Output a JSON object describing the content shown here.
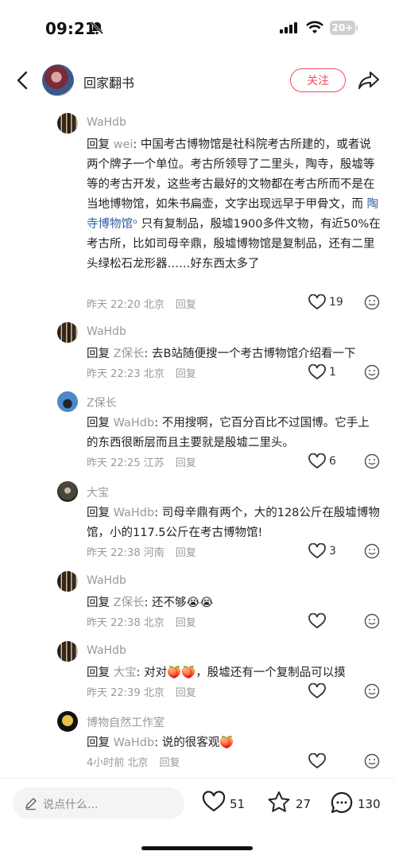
{
  "status": {
    "time": "09:21",
    "battery": "20+"
  },
  "header": {
    "title": "回家翻书",
    "follow_label": "关注"
  },
  "comments": [
    {
      "name": "WaHdb",
      "reply_prefix": "回复 ",
      "reply_to": "wei",
      "text_a": ": 中国考古博物馆是社科院考古所建的，或者说两个牌子一个单位。考古所领导了二里头，陶寺，殷墟等等的考古开发，这些考古最好的文物都在考古所而不是在当地博物馆，如朱书扁壶，文字出现远早于甲骨文，而 ",
      "link": "陶寺博物馆",
      "text_b": " 只有复制品，殷墟1900多件文物，有近50%在考古所，比如司母辛鼎，殷墟博物馆是复制品，还有二里头绿松石龙形器……好东西太多了",
      "time": "昨天 22:20",
      "loc": "北京",
      "reply": "回复",
      "likes": "19"
    },
    {
      "name": "WaHdb",
      "reply_prefix": "回复 ",
      "reply_to": "Z保长",
      "text_a": ": 去B站随便搜一个考古博物馆介绍看一下",
      "time": "昨天 22:23",
      "loc": "北京",
      "reply": "回复",
      "likes": "1"
    },
    {
      "name": "Z保长",
      "reply_prefix": "回复 ",
      "reply_to": "WaHdb",
      "text_a": ": 不用搜啊，它百分百比不过国博。它手上的东西很断层而且主要就是殷墟二里头。",
      "time": "昨天 22:25",
      "loc": "江苏",
      "reply": "回复",
      "likes": "6"
    },
    {
      "name": "大宝",
      "reply_prefix": "回复 ",
      "reply_to": "WaHdb",
      "text_a": ": 司母辛鼎有两个，大的128公斤在殷墟博物馆，小的117.5公斤在考古博物馆!",
      "time": "昨天 22:38",
      "loc": "河南",
      "reply": "回复",
      "likes": "3"
    },
    {
      "name": "WaHdb",
      "reply_prefix": "回复 ",
      "reply_to": "Z保长",
      "text_a": ": 还不够",
      "emoji": "😭😭",
      "time": "昨天 22:38",
      "loc": "北京",
      "reply": "回复"
    },
    {
      "name": "WaHdb",
      "reply_prefix": "回复 ",
      "reply_to": "大宝",
      "text_a": ": 对对",
      "emoji": "🍑🍑",
      "text_b": "，殷墟还有一个复制品可以摸",
      "time": "昨天 22:39",
      "loc": "北京",
      "reply": "回复"
    },
    {
      "name": "博物自然工作室",
      "reply_prefix": "回复 ",
      "reply_to": "WaHdb",
      "text_a": ": 说的很客观",
      "emoji": "🍑",
      "time": "4小时前",
      "loc": "北京",
      "reply": "回复"
    }
  ],
  "bottom": {
    "placeholder": "说点什么...",
    "likes": "51",
    "stars": "27",
    "comments": "130"
  }
}
